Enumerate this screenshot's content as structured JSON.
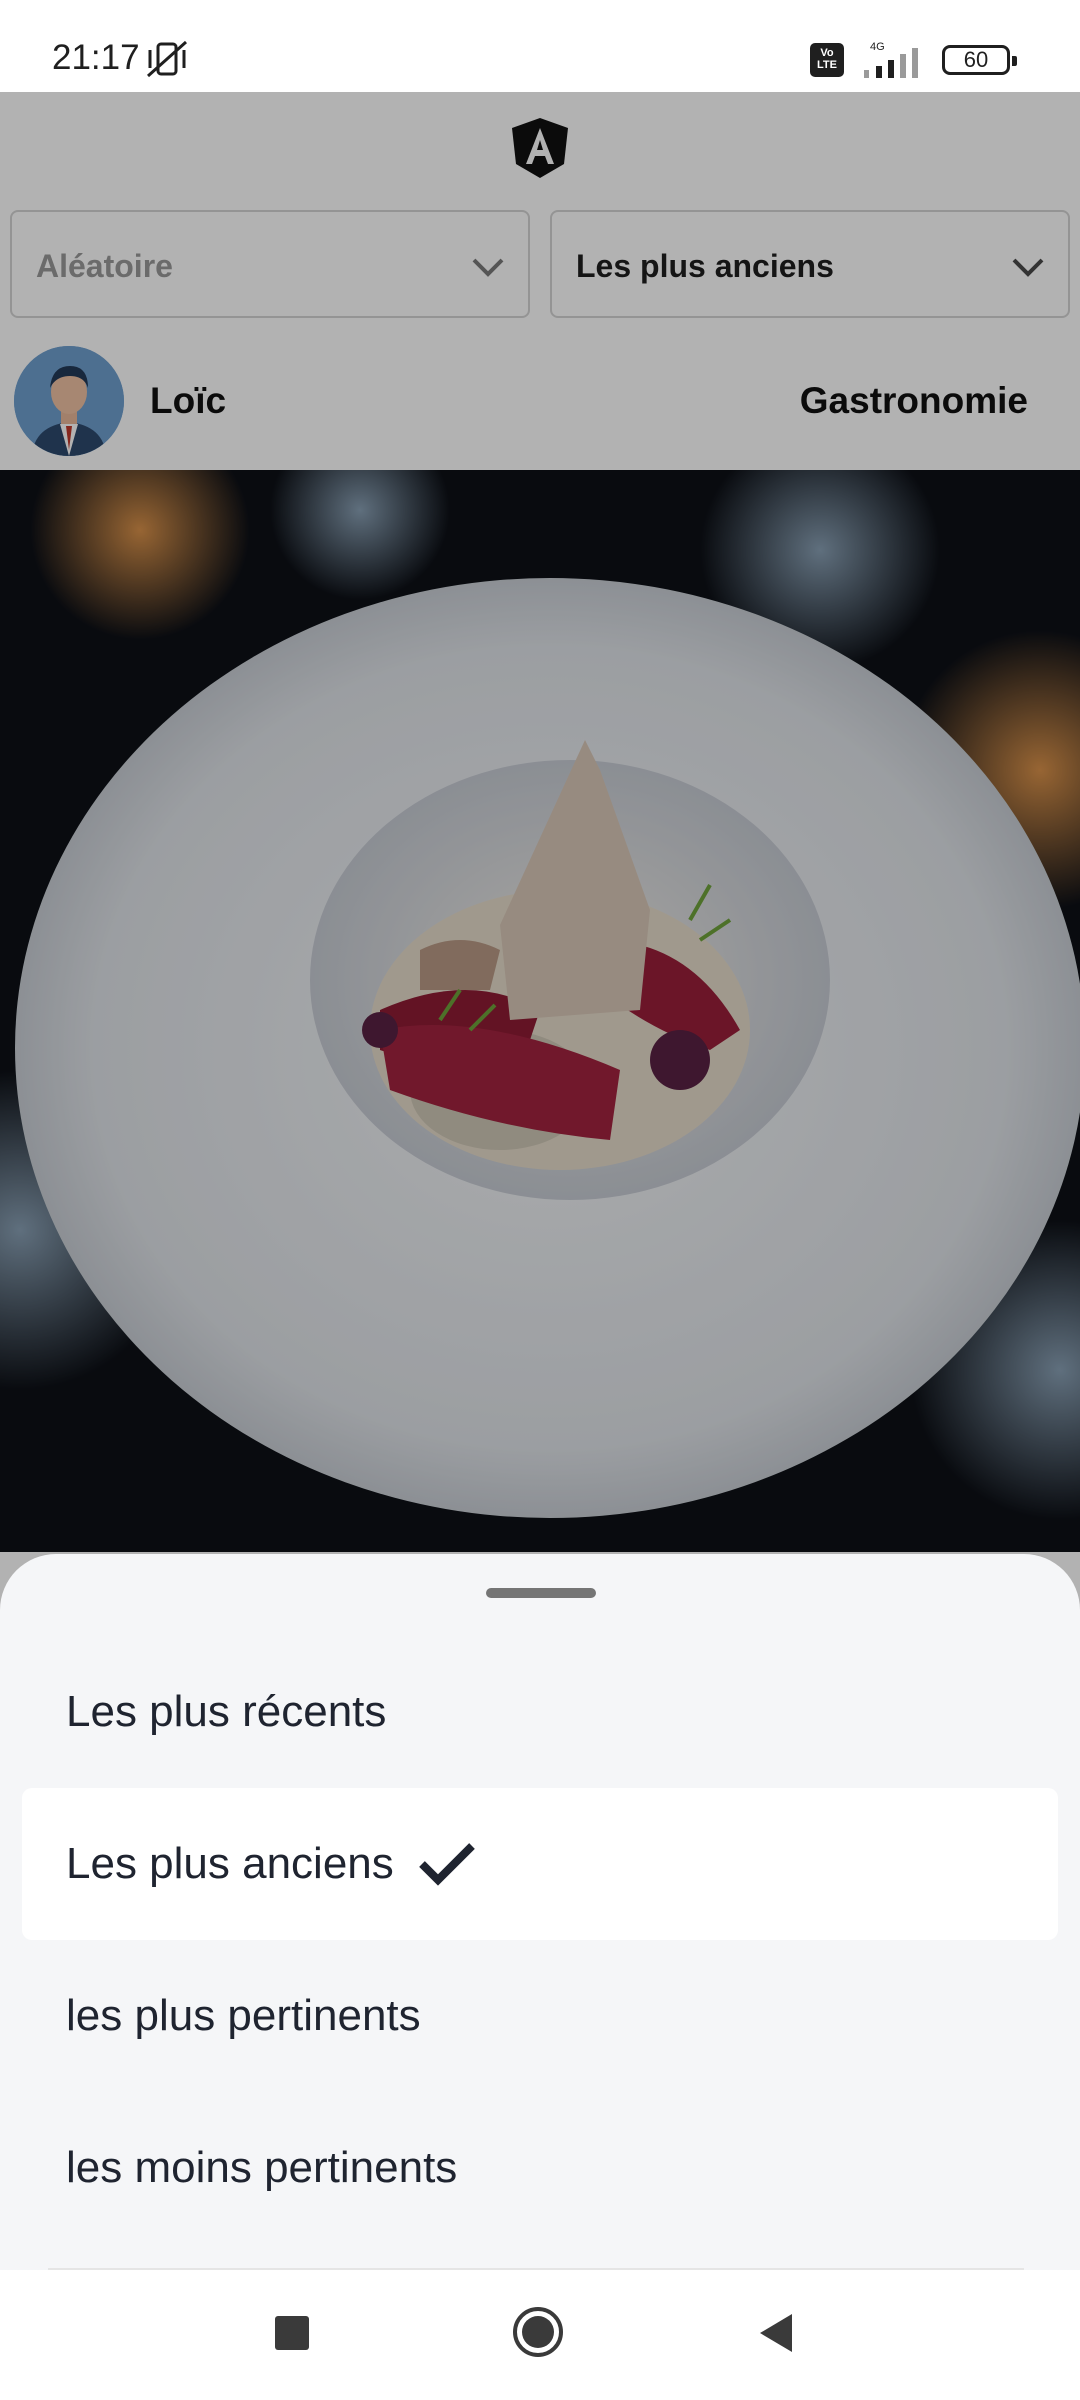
{
  "status_bar": {
    "time": "21:17",
    "network": "4G",
    "volte": "Vo\nLTE",
    "battery": "60"
  },
  "filters": {
    "order_filter": {
      "value": "Aléatoire"
    },
    "sort_filter": {
      "value": "Les plus anciens"
    }
  },
  "post": {
    "author": "Loïc",
    "category": "Gastronomie"
  },
  "sort_sheet": {
    "options": [
      {
        "label": "Les plus récents",
        "selected": false
      },
      {
        "label": "Les plus anciens",
        "selected": true
      },
      {
        "label": "les plus pertinents",
        "selected": false
      },
      {
        "label": "les moins pertinents",
        "selected": false
      }
    ]
  },
  "colors": {
    "sheet_background": "#f5f6f8",
    "text_dark": "#1f2430",
    "scrim": "rgba(0,0,0,0.30)"
  },
  "icons": {
    "logo": "angular-logo-icon",
    "mute": "vibrate-off-icon",
    "chevron": "chevron-down-icon",
    "check": "checkmark-icon",
    "nav_recent": "square-icon",
    "nav_home": "circle-home-icon",
    "nav_back": "triangle-back-icon"
  }
}
